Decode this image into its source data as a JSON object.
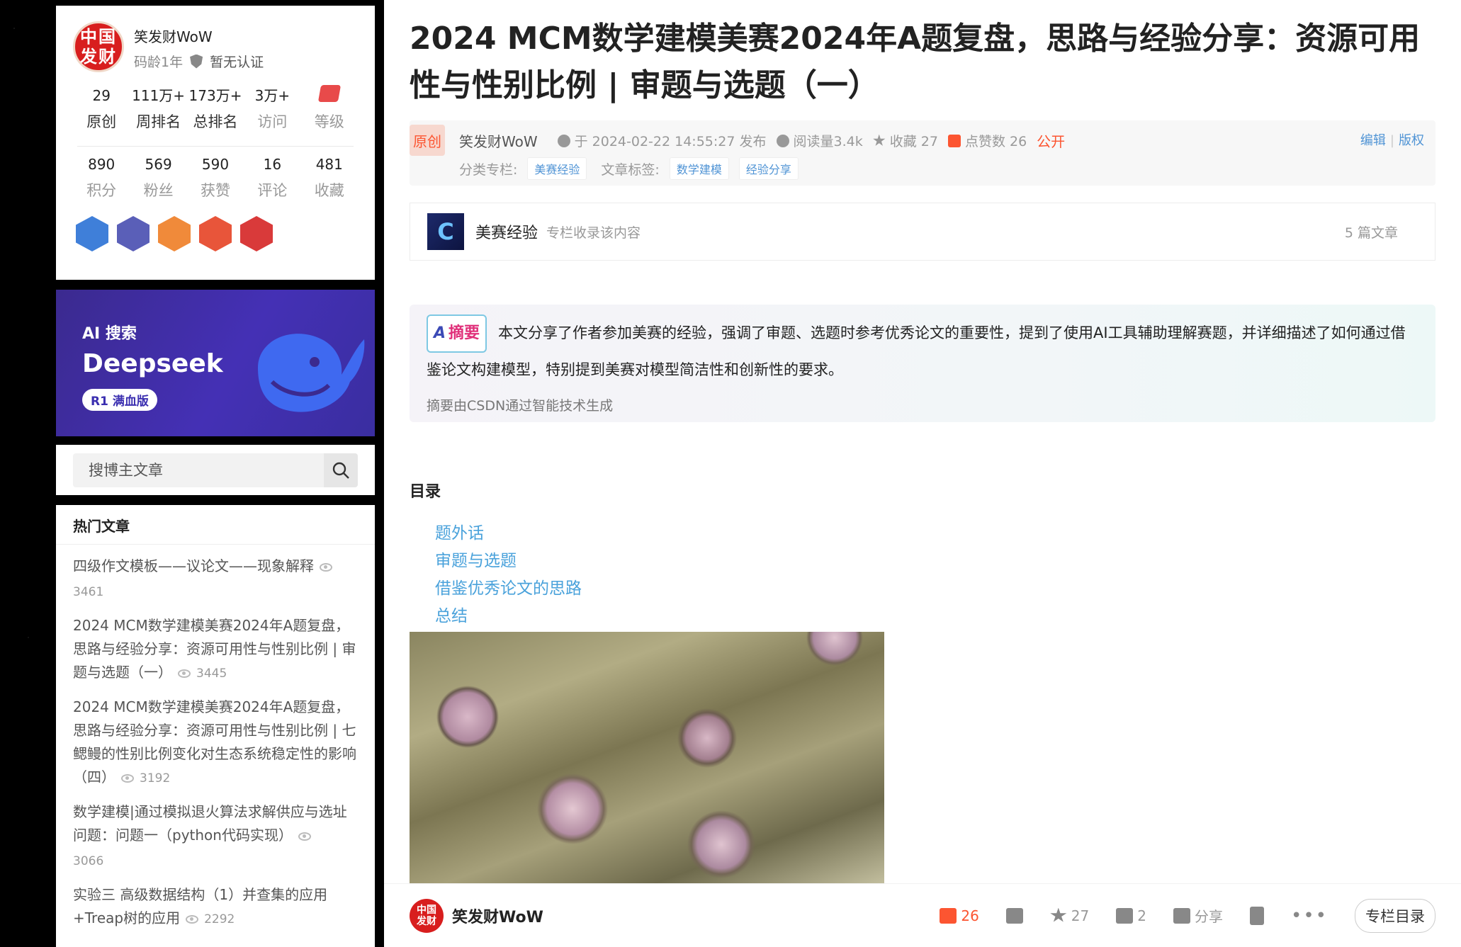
{
  "profile": {
    "avatar_text_line1": "中国",
    "avatar_text_line2": "发财",
    "name": "笑发财WoW",
    "code_age": "码龄1年",
    "verify": "暂无认证",
    "stats": [
      {
        "value": "29",
        "label": "原创"
      },
      {
        "value": "111万+",
        "label": "周排名"
      },
      {
        "value": "173万+",
        "label": "总排名"
      },
      {
        "value": "3万+",
        "label": "访问"
      },
      {
        "value": "",
        "label": "等级"
      }
    ],
    "stats2": [
      {
        "value": "890",
        "label": "积分"
      },
      {
        "value": "569",
        "label": "粉丝"
      },
      {
        "value": "590",
        "label": "获赞"
      },
      {
        "value": "16",
        "label": "评论"
      },
      {
        "value": "481",
        "label": "收藏"
      }
    ],
    "badge_colors": [
      "#3f7fd9",
      "#5a5fb8",
      "#f08a3a",
      "#e8553a",
      "#d93a3a"
    ]
  },
  "ad": {
    "small": "AI 搜索",
    "big": "Deepseek",
    "pill": "R1 满血版",
    "whale_color": "#3f69f0"
  },
  "search": {
    "placeholder": "搜博主文章"
  },
  "hot": {
    "title": "热门文章",
    "items": [
      {
        "title": "四级作文模板——议论文——现象解释",
        "views": "3461"
      },
      {
        "title": "2024 MCM数学建模美赛2024年A题复盘，思路与经验分享：资源可用性与性别比例 | 审题与选题（一）",
        "views": "3445"
      },
      {
        "title": "2024 MCM数学建模美赛2024年A题复盘，思路与经验分享：资源可用性与性别比例 | 七鳃鳗的性别比例变化对生态系统稳定性的影响（四）",
        "views": "3192"
      },
      {
        "title": "数学建模|通过模拟退火算法求解供应与选址问题：问题一（python代码实现）",
        "views": "3066"
      },
      {
        "title": "实验三 高级数据结构（1）并查集的应用+Treap树的应用",
        "views": "2292"
      }
    ]
  },
  "article": {
    "title": "2024 MCM数学建模美赛2024年A题复盘，思路与经验分享：资源可用性与性别比例 | 审题与选题（一）",
    "orig_label": "原创",
    "author": "笑发财WoW",
    "published": "于 2024-02-22 14:55:27 发布",
    "reads": "阅读量3.4k",
    "favs": "收藏 27",
    "likes": "点赞数 26",
    "visibility": "公开",
    "edit": "编辑",
    "copyright": "版权",
    "category_label": "分类专栏:",
    "category": "美赛经验",
    "tags_label": "文章标签:",
    "tags": [
      "数学建模",
      "经验分享"
    ],
    "accent": "#fc5531",
    "link_color": "#4aa2db"
  },
  "column": {
    "thumb_letter": "C",
    "name": "美赛经验",
    "desc": "专栏收录该内容",
    "count": "5 篇文章"
  },
  "summary": {
    "badge": "摘要",
    "text": "本文分享了作者参加美赛的经验，强调了审题、选题时参考优秀论文的重要性，提到了使用AI工具辅助理解赛题，并详细描述了如何通过借鉴论文构建模型，特别提到美赛对模型简洁性和创新性的要求。",
    "foot": "摘要由CSDN通过智能技术生成"
  },
  "toc": {
    "title": "目录",
    "items": [
      "题外话",
      "审题与选题",
      "借鉴优秀论文的思路",
      "总结"
    ]
  },
  "bottombar": {
    "avatar_line1": "中国",
    "avatar_line2": "发财",
    "name": "笑发财WoW",
    "likes": "26",
    "favs": "27",
    "comments": "2",
    "share": "分享",
    "toc_button": "专栏目录"
  }
}
